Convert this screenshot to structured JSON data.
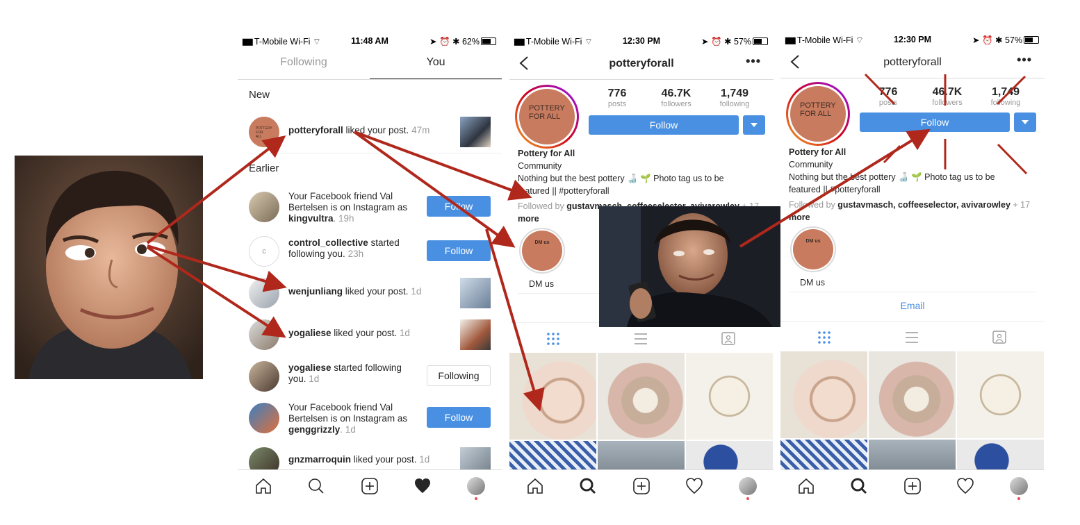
{
  "colors": {
    "accent": "#4a90e2",
    "arrow": "#b0281c",
    "muted": "#999999"
  },
  "status1": {
    "carrier": "T-Mobile Wi-Fi",
    "time": "11:48 AM",
    "battery": "62%"
  },
  "status2": {
    "carrier": "T-Mobile Wi-Fi",
    "time": "12:30 PM",
    "battery": "57%"
  },
  "status3": {
    "carrier": "T-Mobile Wi-Fi",
    "time": "12:30 PM",
    "battery": "57%"
  },
  "activity": {
    "tabs": [
      "Following",
      "You"
    ],
    "new_header": "New",
    "earlier_header": "Earlier",
    "rows": [
      {
        "user": "potteryforall",
        "text": " liked your post.",
        "time": " 47m"
      },
      {
        "pre": "Your Facebook friend Val Bertelsen is on Instagram as ",
        "user": "kingvultra",
        "time": ". 19h",
        "button": "Follow"
      },
      {
        "user": "control_collective",
        "text": " started following you.",
        "time": " 23h",
        "button": "Follow"
      },
      {
        "user": "wenjunliang",
        "text": " liked your post.",
        "time": " 1d"
      },
      {
        "user": "yogaliese",
        "text": " liked your post.",
        "time": " 1d"
      },
      {
        "user": "yogaliese",
        "text": " started following you.",
        "time": " 1d",
        "button": "Following"
      },
      {
        "pre": "Your Facebook friend Val Bertelsen is on Instagram as ",
        "user": "genggrizzly",
        "time": ". 1d",
        "button": "Follow"
      },
      {
        "user": "gnzmarroquin",
        "text": " liked your post.",
        "time": " 1d"
      }
    ]
  },
  "profile": {
    "username": "potteryforall",
    "avatar_text": "POTTERY FOR ALL",
    "posts": "776",
    "posts_label": "posts",
    "followers": "46.7K",
    "followers_label": "followers",
    "following": "1,749",
    "following_label": "following",
    "follow_button": "Follow",
    "name": "Pottery for All",
    "category": "Community",
    "bio_line1": "Nothing but the best pottery 🍶 🌱 Photo tag us to be",
    "bio_line2": "featured || #potteryforall",
    "followed_by_prefix": "Followed by ",
    "followed_by_users": "gustavmasch, coffeeselector, avivarowley",
    "followed_by_suffix": " + 17",
    "followed_by_more": "more",
    "highlight_label": "DM us",
    "highlight_title": "DM us",
    "email_button": "Email"
  }
}
